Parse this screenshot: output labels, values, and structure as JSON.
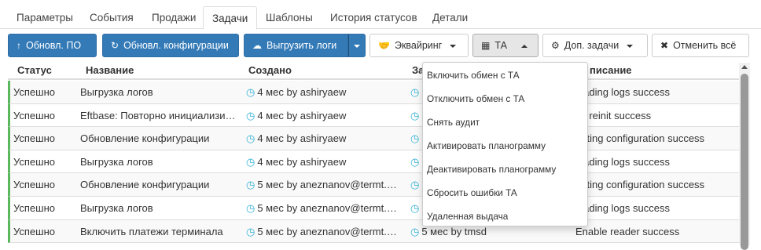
{
  "tabs": [
    "Параметры",
    "События",
    "Продажи",
    "Задачи",
    "Шаблоны",
    "История статусов",
    "Детали"
  ],
  "toolbar": {
    "update_po": "Обновл. ПО",
    "update_config": "Обновл. конфигурации",
    "upload_logs": "Выгрузить логи",
    "acquiring": "Эквайринг",
    "ta": "ТА",
    "extra_tasks": "Доп. задачи",
    "cancel_all": "Отменить всё"
  },
  "table": {
    "headers": {
      "status": "Статус",
      "name": "Название",
      "created": "Создано",
      "col4_visible": "За",
      "col5_visible": "писание"
    },
    "rows": [
      {
        "status": "Успешно",
        "name": "Выгрузка логов",
        "created": "4 мес by ashiryaew",
        "col4": "",
        "desc": "loading logs success"
      },
      {
        "status": "Успешно",
        "name": "Eftbase: Повторно инициализи…",
        "created": "4 мес by ashiryaew",
        "col4": "",
        "desc": "nk reinit success"
      },
      {
        "status": "Успешно",
        "name": "Обновление конфигурации",
        "created": "4 мес by ashiryaew",
        "col4": "",
        "desc": "dating configuration success"
      },
      {
        "status": "Успешно",
        "name": "Выгрузка логов",
        "created": "4 мес by ashiryaew",
        "col4": "",
        "desc": "loading logs success"
      },
      {
        "status": "Успешно",
        "name": "Обновление конфигурации",
        "created": "5 мес by aneznanov@termt.…",
        "col4": "",
        "desc": "dating configuration success"
      },
      {
        "status": "Успешно",
        "name": "Выгрузка логов",
        "created": "5 мес by aneznanov@termt.…",
        "col4": "",
        "desc": "loading logs success"
      },
      {
        "status": "Успешно",
        "name": "Включить платежи терминала",
        "created": "5 мес by aneznanov@termt.…",
        "col4": "5 мес by tmsd",
        "desc": "Enable reader success"
      }
    ]
  },
  "ta_menu": [
    "Включить обмен с ТА",
    "Отключить обмен с ТА",
    "Снять аудит",
    "Активировать планограмму",
    "Деактивировать планограмму",
    "Сбросить ошибки ТА",
    "Удаленная выдача"
  ],
  "colors": {
    "primary": "#337ab7",
    "success_border": "#5cb85c",
    "clock": "#31b0d5"
  },
  "icons": {
    "update_po": "arrow-up-icon",
    "update_config": "refresh-icon",
    "upload_logs": "cloud-upload-icon",
    "acquiring": "handshake-icon",
    "ta": "grid-icon",
    "extra_tasks": "cogs-icon",
    "cancel_all": "times-circle-icon",
    "created": "clock-icon"
  }
}
